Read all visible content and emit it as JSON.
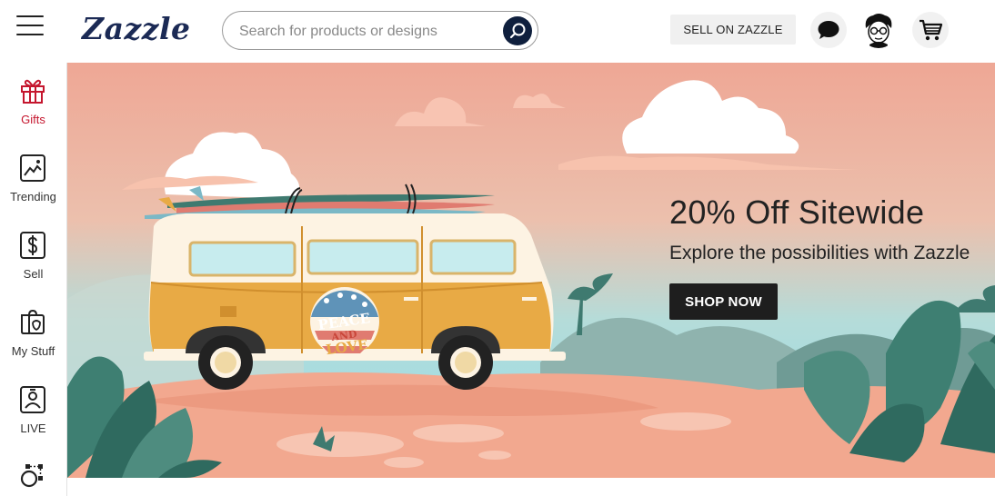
{
  "header": {
    "logo": "Zazzle",
    "search_placeholder": "Search for products or designs",
    "sell_label": "SELL ON ZAZZLE"
  },
  "sidebar": {
    "items": [
      {
        "label": "Gifts",
        "icon": "gift-icon",
        "active": true
      },
      {
        "label": "Trending",
        "icon": "trending-image-icon"
      },
      {
        "label": "Sell",
        "icon": "dollar-icon"
      },
      {
        "label": "My Stuff",
        "icon": "my-stuff-icon"
      },
      {
        "label": "LIVE",
        "icon": "live-icon"
      },
      {
        "label": "",
        "icon": "design-nodes-icon"
      }
    ]
  },
  "banner": {
    "title": "20% Off Sitewide",
    "subtitle": "Explore the possibilities with Zazzle",
    "cta": "SHOP NOW",
    "van_text_1": "PEACE",
    "van_text_2": "AND",
    "van_text_3": "LOVE"
  },
  "colors": {
    "brand": "#1b2a55",
    "accent_red": "#c5162e",
    "sky_top": "#eea896",
    "sky_bottom": "#a6dbe0",
    "sand": "#f2a88f",
    "van": "#e8aa45"
  }
}
